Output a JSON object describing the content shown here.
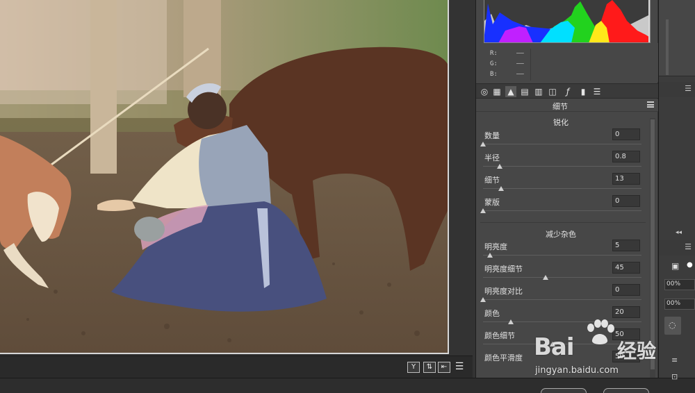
{
  "panel": {
    "title": "细节",
    "sharpen": {
      "heading": "锐化",
      "controls": [
        {
          "label": "数量",
          "value": "0",
          "level": 0.0
        },
        {
          "label": "半径",
          "value": "0.8",
          "level": 0.12
        },
        {
          "label": "细节",
          "value": "13",
          "level": 0.13
        },
        {
          "label": "蒙版",
          "value": "0",
          "level": 0.0
        }
      ]
    },
    "noise": {
      "heading": "减少杂色",
      "controls": [
        {
          "label": "明亮度",
          "value": "5",
          "level": 0.05
        },
        {
          "label": "明亮度细节",
          "value": "45",
          "level": 0.45
        },
        {
          "label": "明亮度对比",
          "value": "0",
          "level": 0.0
        },
        {
          "label": "颜色",
          "value": "20",
          "level": 0.2
        },
        {
          "label": "颜色细节",
          "value": "50",
          "level": 0.5
        },
        {
          "label": "颜色平滑度",
          "value": "50",
          "level": 0.5
        }
      ]
    }
  },
  "readout": {
    "r_label": "R:",
    "r_value": "——",
    "g_label": "G:",
    "g_value": "——",
    "b_label": "B:",
    "b_value": "——"
  },
  "tools": [
    "aperture-icon",
    "grid-icon",
    "mountains-icon",
    "split-icon",
    "bars-icon",
    "lens-icon",
    "fx-icon",
    "film-icon",
    "sliders-icon"
  ],
  "preview_buttons": {
    "y_label": "Y"
  },
  "far_right": {
    "zoom1": "00%",
    "zoom2": "00%"
  },
  "watermark": {
    "brand_text": "Bai",
    "brand_suffix": "经验",
    "url": "jingyan.baidu.com"
  },
  "colors": {
    "panel_bg": "#474747",
    "field_bg": "#383838",
    "app_bg": "#333333"
  }
}
